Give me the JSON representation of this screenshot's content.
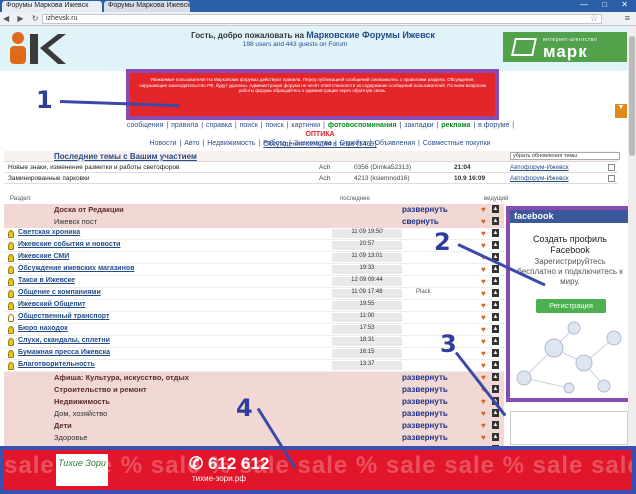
{
  "browser": {
    "tabs": [
      "Форумы Маркова Ижевск",
      "Форумы Маркова Ижевск"
    ],
    "url": "izhevsk.ru"
  },
  "header": {
    "welcome_prefix": "Гость",
    "welcome_text": ", добро пожаловать на",
    "site_name": "Марковские Форумы Ижевск",
    "online_line1": "198 users and 443 guests on Forum",
    "online_line2": "",
    "mark_banner": {
      "sub": "интернет-агентство",
      "word": "марк"
    }
  },
  "notice": {
    "text": "Уважаемые пользователи! На Марковских форумах действуют правила. Перед публикацией сообщений ознакомьтесь с правилами раздела. Обсуждения, нарушающие законодательство РФ, будут удалены. Администрация форума не несёт ответственности за содержание сообщений пользователей. По всем вопросам работы форума обращайтесь к администрации через обратную связь."
  },
  "markers": [
    "1",
    "2",
    "3",
    "4"
  ],
  "nav": {
    "links": [
      "сообщения",
      "правила",
      "справка",
      "поиск",
      "поиск",
      "картинки",
      "фотовоспоминания",
      "закладки",
      "реклама",
      "в форуме",
      "ОПТИКА"
    ],
    "links2": [
      "Новости",
      "Авто",
      "Недвижимость",
      "Работа",
      "Знакомства",
      "Стройка",
      "Объявления",
      "Совместные покупки"
    ],
    "sublink": "Обсуждения сегодня в теме (1469)"
  },
  "latest": {
    "title": "Последние темы с Вашим участием",
    "select": "убрать обновления темы",
    "rows": [
      {
        "topic": "Новые знаки, изменение разметки и работы светофоров",
        "c2": "Ach",
        "c3": "0356 (Dimka52313)",
        "time": "21:04",
        "who": "Автофорум-Ижевск"
      },
      {
        "topic": "Заминированные парковки",
        "c2": "Ach",
        "c3": "4213 (ksiemnod16)",
        "time": "10.9 16:09",
        "who": "Автофорум-Ижевск"
      }
    ]
  },
  "forum": {
    "col_section": "Раздел:",
    "col_last": "последнее",
    "col_lead": "ведущий",
    "rows": [
      {
        "type": "cat",
        "name": "Доска от Редакции",
        "expand": "развернуть"
      },
      {
        "type": "cat",
        "name": "Ижевск пост",
        "expand": "свернуть",
        "plain": true
      },
      {
        "type": "sub",
        "name": "Светская хроника",
        "date": "11 09 19:50",
        "who": "",
        "bulb": true
      },
      {
        "type": "sub",
        "name": "Ижевские события и новости",
        "date": "20:57",
        "who": "",
        "bulb": true
      },
      {
        "type": "sub",
        "name": "Ижевские СМИ",
        "date": "11 09 13:01",
        "who": "",
        "bulb": true
      },
      {
        "type": "sub",
        "name": "Обсуждение ижевских магазинов",
        "date": "19:33",
        "who": "",
        "bulb": true
      },
      {
        "type": "sub",
        "name": "Такси в Ижевске",
        "date": "12 09 09:44",
        "who": "",
        "bulb": true
      },
      {
        "type": "sub",
        "name": "Общение с компаниями",
        "date": "11 09 17:48",
        "who": "Plack",
        "bulb": true
      },
      {
        "type": "sub",
        "name": "Ижевский Общепит",
        "date": "19:55",
        "who": "",
        "bulb": true
      },
      {
        "type": "sub",
        "name": "Общественный транспорт",
        "date": "11:00",
        "who": "",
        "bulb": false
      },
      {
        "type": "sub",
        "name": "Бюро находок",
        "date": "17:53",
        "who": "",
        "bulb": true
      },
      {
        "type": "sub",
        "name": "Слухи, скандалы, сплетни",
        "date": "18:31",
        "who": "",
        "bulb": true
      },
      {
        "type": "sub",
        "name": "Бумажная пресса Ижевска",
        "date": "16:15",
        "who": "",
        "bulb": true
      },
      {
        "type": "sub",
        "name": "Благотворительность",
        "date": "13:37",
        "who": "",
        "bulb": true
      },
      {
        "type": "cat",
        "name": "Афиша: Культура, искусство, отдых",
        "expand": "развернуть"
      },
      {
        "type": "cat",
        "name": "Строительство и ремонт",
        "expand": "развернуть"
      },
      {
        "type": "cat",
        "name": "Недвижимость",
        "expand": "развернуть"
      },
      {
        "type": "cat",
        "name": "Дом, хозяйство",
        "expand": "развернуть",
        "plain": true
      },
      {
        "type": "cat",
        "name": "Дети",
        "expand": "развернуть"
      },
      {
        "type": "cat",
        "name": "Здоровье",
        "expand": "развернуть",
        "plain": true
      },
      {
        "type": "cat",
        "name": "Объявления",
        "expand": "развернуть",
        "plain": true
      }
    ]
  },
  "facebook": {
    "brand": "facebook",
    "title": "Создать профиль Facebook",
    "text": "Зарегистрируйтесь бесплатно и подключитесь к миру.",
    "button": "Регистрация"
  },
  "sale": {
    "logo_text": "Тихие Зори",
    "phone": "612 612",
    "site": "тихие-зори.рф",
    "bg": "sale sale % sale % sale sale % sale sale % sale sale sale"
  },
  "colors": {
    "accent_purple": "#8a4bb1",
    "marker_blue": "#2f3e9e",
    "sale_red": "#e2162a",
    "fb_blue": "#3b5998"
  }
}
